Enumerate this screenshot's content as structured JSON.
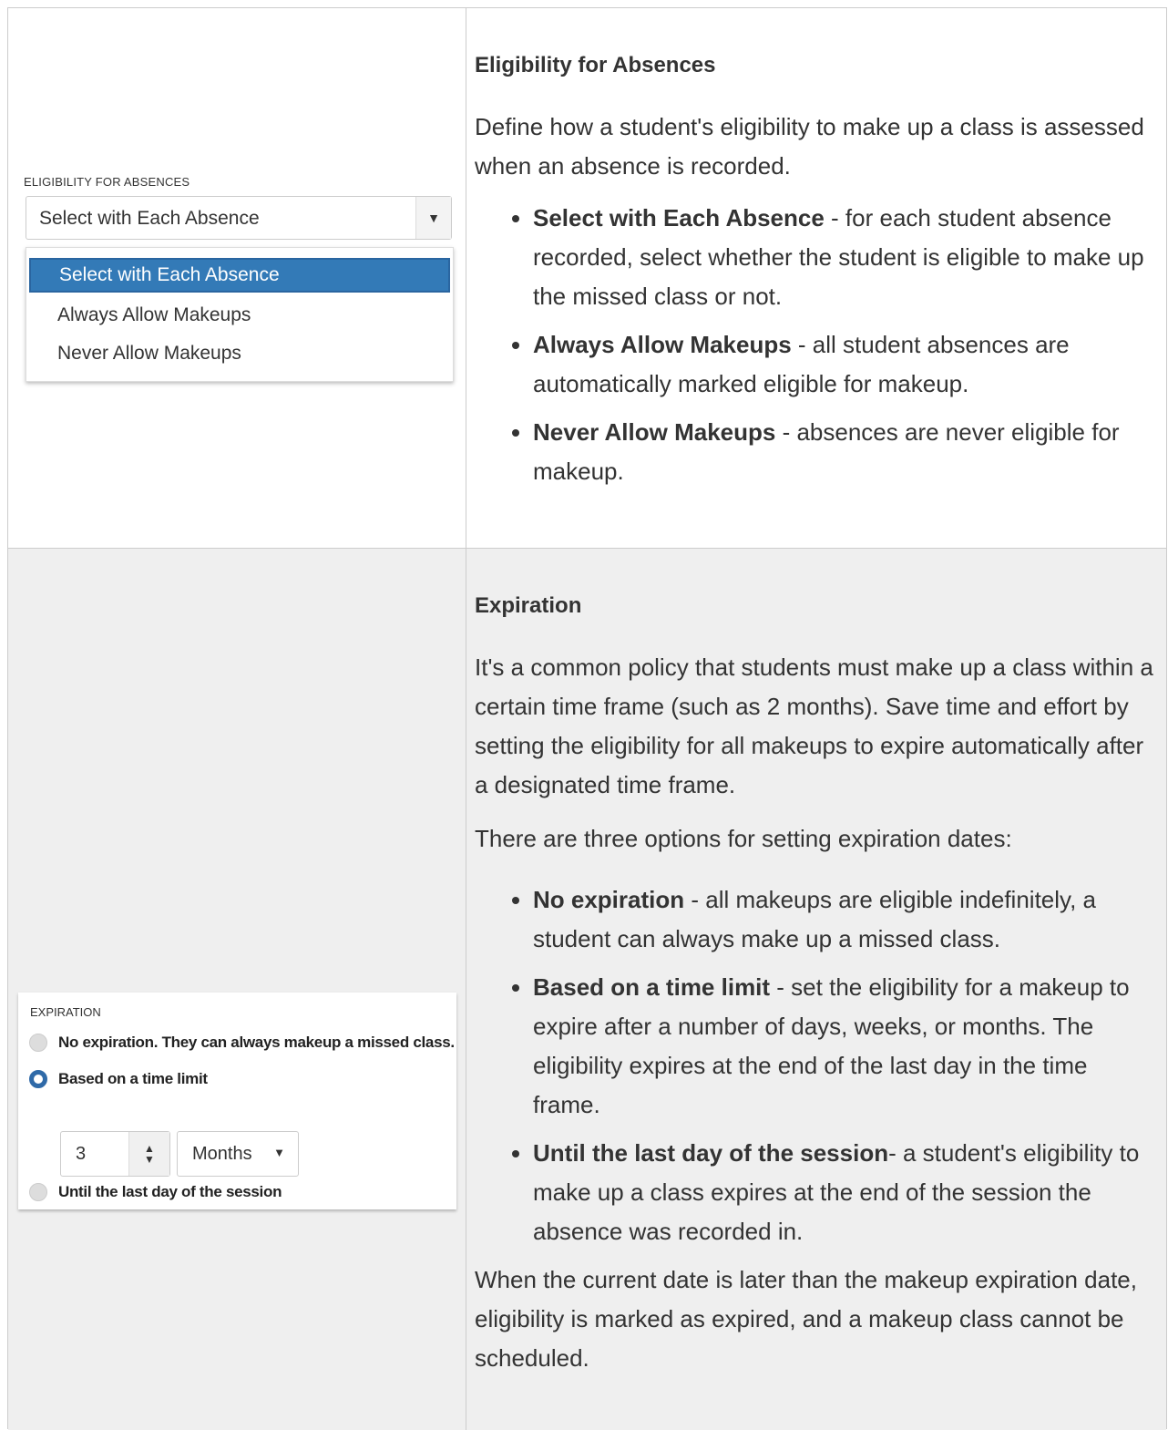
{
  "section1": {
    "heading": "Eligibility for Absences",
    "intro": "Define how a student's eligibility to make up a class is assessed when an absence is recorded.",
    "items": [
      {
        "term": "Select with Each Absence",
        "desc": " - for each student absence recorded, select whether the student is eligible to make up the missed class or not."
      },
      {
        "term": "Always Allow Makeups",
        "desc": " - all student absences are automatically marked eligible for makeup."
      },
      {
        "term": "Never Allow Makeups",
        "desc": " - absences are never eligible for makeup."
      }
    ],
    "widget": {
      "label": "ELIGIBILITY FOR ABSENCES",
      "selected": "Select with Each Absence",
      "caret": "▼",
      "options": [
        "Select with Each Absence",
        "Always Allow Makeups",
        "Never Allow Makeups"
      ]
    }
  },
  "section2": {
    "heading": "Expiration",
    "intro": "It's a common policy that students must make up a class within a certain time frame (such as 2 months). Save time and effort by setting the eligibility for all makeups to expire automatically after a designated time frame.",
    "lead": "There are three options for setting expiration dates:",
    "items": [
      {
        "term": "No expiration",
        "desc": " - all makeups are eligible indefinitely, a student can always make up a missed class."
      },
      {
        "term": "Based on a time limit",
        "desc": " - set the eligibility for a makeup to expire after a number of days, weeks, or months. The eligibility expires at the end of the last day in the time frame."
      },
      {
        "term": "Until the last day of the session",
        "desc": "- a student's eligibility to make up a class expires at the end of the session the absence was recorded in."
      }
    ],
    "outro": "When the current date is later than the makeup expiration date, eligibility is marked as expired, and a makeup class cannot be scheduled.",
    "widget": {
      "label": "EXPIRATION",
      "options": [
        {
          "text": "No expiration. They can always makeup a missed class.",
          "checked": false
        },
        {
          "text": "Based on a time limit",
          "checked": true
        },
        {
          "text": "Until the last day of the session",
          "checked": false
        }
      ],
      "amount": "3",
      "unit": "Months",
      "stepper_up": "▲",
      "stepper_down": "▼",
      "unit_caret": "▼"
    }
  },
  "colors": {
    "selected_option": "#337ab7",
    "radio_checked": "#2f6aa8",
    "row2_bg": "#efefef"
  }
}
